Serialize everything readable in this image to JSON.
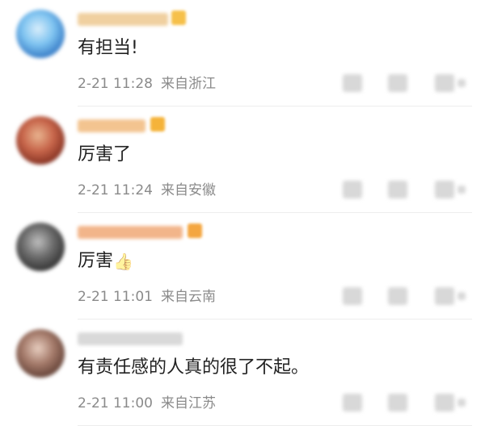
{
  "comments": [
    {
      "text": "有担当!",
      "time": "2-21 11:28",
      "location": "来自浙江",
      "avatar_icon": "blurred-avatar-icon",
      "avatar_colors": [
        "#2a6fbf",
        "#7ec3f0",
        "#d9eefb"
      ],
      "name_color": "#f0d0a0",
      "badge_color": "#f6c04a"
    },
    {
      "text": "厉害了",
      "time": "2-21 11:24",
      "location": "来自安徽",
      "avatar_icon": "blurred-avatar-icon",
      "avatar_colors": [
        "#7a2a1c",
        "#c7654a",
        "#e9b48f"
      ],
      "name_color": "#f3c490",
      "badge_color": "#f5b33a"
    },
    {
      "text": "厉害",
      "emoji": "👍",
      "time": "2-21 11:01",
      "location": "来自云南",
      "avatar_icon": "blurred-avatar-icon",
      "avatar_colors": [
        "#2b2b2b",
        "#6a6a6a",
        "#bdbdbd"
      ],
      "name_color": "#f2b58a",
      "badge_color": "#f4a640"
    },
    {
      "text": "有责任感的人真的很了不起。",
      "time": "2-21 11:00",
      "location": "来自江苏",
      "avatar_icon": "blurred-avatar-icon",
      "avatar_colors": [
        "#5a3a30",
        "#a47a6a",
        "#e7cdbf"
      ],
      "name_color": "#d9d9d9",
      "badge_color": ""
    }
  ],
  "action_icons": [
    "share-icon",
    "comment-icon",
    "like-icon"
  ]
}
